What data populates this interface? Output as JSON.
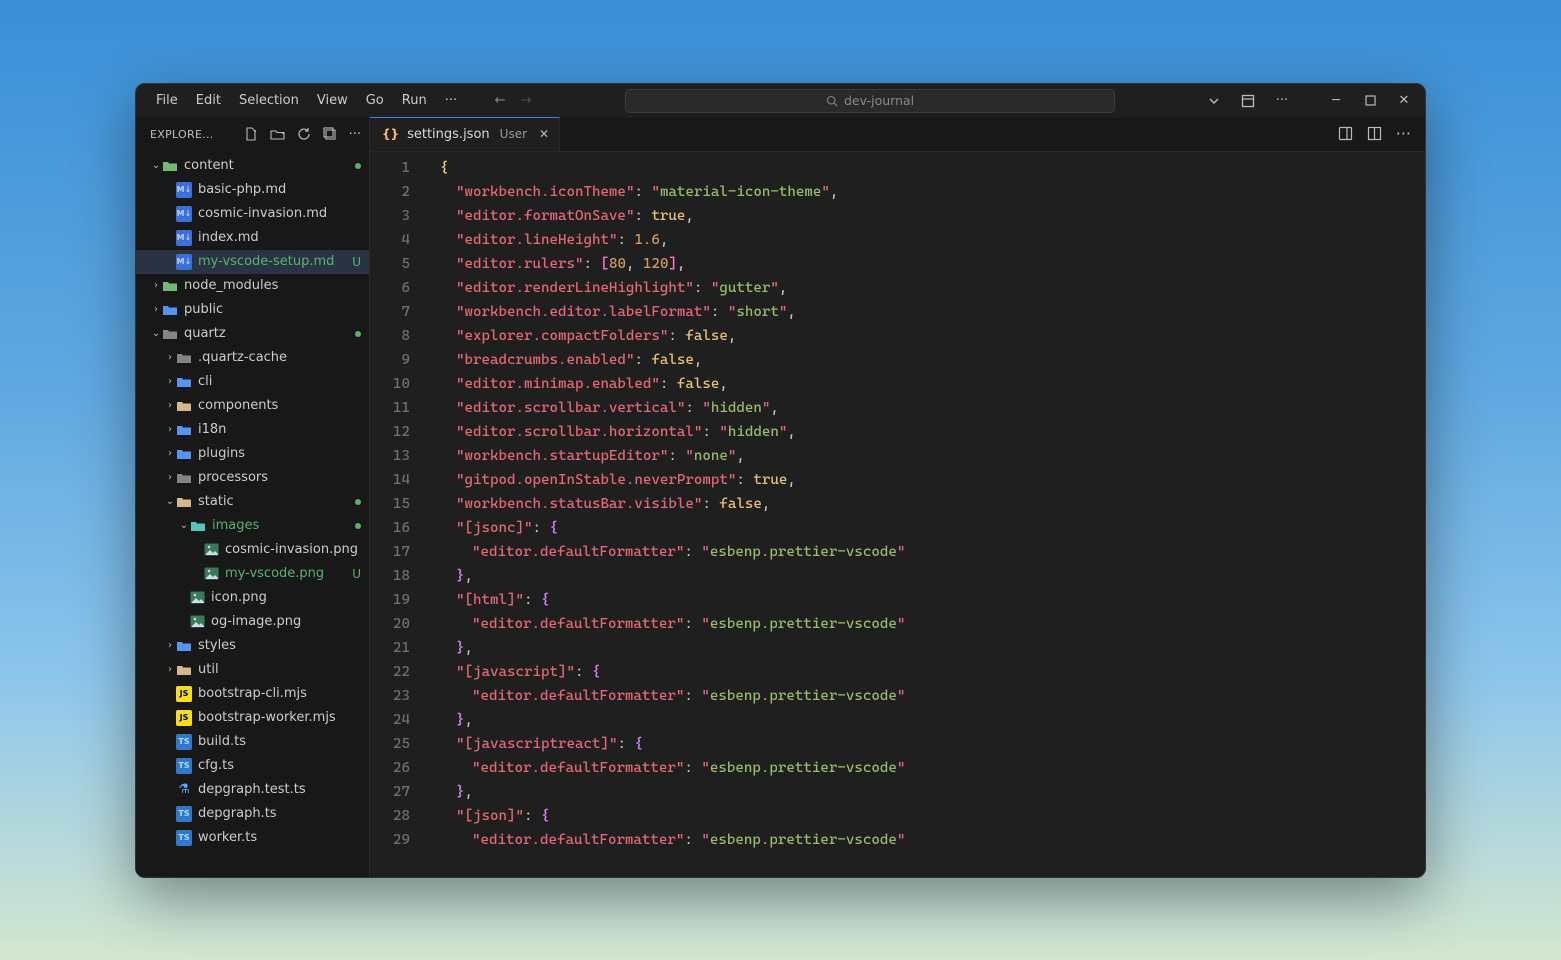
{
  "menu": {
    "file": "File",
    "edit": "Edit",
    "selection": "Selection",
    "view": "View",
    "go": "Go",
    "run": "Run"
  },
  "search_placeholder": "dev-journal",
  "sidebar": {
    "title": "EXPLORE...",
    "tree": [
      {
        "type": "folder",
        "label": "content",
        "indent": 0,
        "exp": true,
        "color": "green",
        "dot": true
      },
      {
        "type": "file",
        "label": "basic-php.md",
        "indent": 1,
        "badge": "M↓",
        "badgecls": "file-md"
      },
      {
        "type": "file",
        "label": "cosmic-invasion.md",
        "indent": 1,
        "badge": "M↓",
        "badgecls": "file-md"
      },
      {
        "type": "file",
        "label": "index.md",
        "indent": 1,
        "badge": "M↓",
        "badgecls": "file-md"
      },
      {
        "type": "file",
        "label": "my-vscode-setup.md",
        "indent": 1,
        "badge": "M↓",
        "badgecls": "file-md",
        "selected": true,
        "u": true,
        "labelcls": "green"
      },
      {
        "type": "folder",
        "label": "node_modules",
        "indent": 0,
        "exp": false,
        "color": "green"
      },
      {
        "type": "folder",
        "label": "public",
        "indent": 0,
        "exp": false,
        "color": "blue"
      },
      {
        "type": "folder",
        "label": "quartz",
        "indent": 0,
        "exp": true,
        "color": "grey",
        "dot": true
      },
      {
        "type": "folder",
        "label": ".quartz-cache",
        "indent": 1,
        "exp": false,
        "color": "grey"
      },
      {
        "type": "folder",
        "label": "cli",
        "indent": 1,
        "exp": false,
        "color": "blue"
      },
      {
        "type": "folder",
        "label": "components",
        "indent": 1,
        "exp": false,
        "color": "yellow"
      },
      {
        "type": "folder",
        "label": "i18n",
        "indent": 1,
        "exp": false,
        "color": "blue"
      },
      {
        "type": "folder",
        "label": "plugins",
        "indent": 1,
        "exp": false,
        "color": "blue"
      },
      {
        "type": "folder",
        "label": "processors",
        "indent": 1,
        "exp": false,
        "color": "grey"
      },
      {
        "type": "folder",
        "label": "static",
        "indent": 1,
        "exp": true,
        "color": "yellow",
        "dot": true
      },
      {
        "type": "folder",
        "label": "images",
        "indent": 2,
        "exp": true,
        "color": "teal",
        "labelcls": "green",
        "dot": true
      },
      {
        "type": "file",
        "label": "cosmic-invasion.png",
        "indent": 3,
        "badge": "",
        "badgecls": "png-badge"
      },
      {
        "type": "file",
        "label": "my-vscode.png",
        "indent": 3,
        "badge": "",
        "badgecls": "png-badge",
        "u": true,
        "labelcls": "green"
      },
      {
        "type": "file",
        "label": "icon.png",
        "indent": 2,
        "badge": "",
        "badgecls": "png-badge"
      },
      {
        "type": "file",
        "label": "og-image.png",
        "indent": 2,
        "badge": "",
        "badgecls": "png-badge"
      },
      {
        "type": "folder",
        "label": "styles",
        "indent": 1,
        "exp": false,
        "color": "blue"
      },
      {
        "type": "folder",
        "label": "util",
        "indent": 1,
        "exp": false,
        "color": "yellow"
      },
      {
        "type": "file",
        "label": "bootstrap-cli.mjs",
        "indent": 1,
        "badge": "JS",
        "badgecls": "js-badge"
      },
      {
        "type": "file",
        "label": "bootstrap-worker.mjs",
        "indent": 1,
        "badge": "JS",
        "badgecls": "js-badge"
      },
      {
        "type": "file",
        "label": "build.ts",
        "indent": 1,
        "badge": "TS",
        "badgecls": "ts-badge"
      },
      {
        "type": "file",
        "label": "cfg.ts",
        "indent": 1,
        "badge": "TS",
        "badgecls": "ts-badge"
      },
      {
        "type": "file",
        "label": "depgraph.test.ts",
        "indent": 1,
        "badge": "⚗",
        "badgecls": "test-badge"
      },
      {
        "type": "file",
        "label": "depgraph.ts",
        "indent": 1,
        "badge": "TS",
        "badgecls": "ts-badge"
      },
      {
        "type": "file",
        "label": "worker.ts",
        "indent": 1,
        "badge": "TS",
        "badgecls": "ts-badge"
      }
    ]
  },
  "tab": {
    "icon": "{}",
    "name": "settings.json",
    "scope": "User"
  },
  "code": {
    "lines": [
      [
        [
          "brace",
          "{"
        ]
      ],
      [
        [
          "ind",
          1
        ],
        [
          "q"
        ],
        [
          "key",
          "workbench.iconTheme"
        ],
        [
          "q"
        ],
        [
          "colon",
          ": "
        ],
        [
          "q"
        ],
        [
          "str",
          "material-icon-theme"
        ],
        [
          "q"
        ],
        [
          "punc",
          ","
        ]
      ],
      [
        [
          "ind",
          1
        ],
        [
          "q"
        ],
        [
          "key",
          "editor.formatOnSave"
        ],
        [
          "q"
        ],
        [
          "colon",
          ": "
        ],
        [
          "bool",
          "true"
        ],
        [
          "punc",
          ","
        ]
      ],
      [
        [
          "ind",
          1
        ],
        [
          "q"
        ],
        [
          "key",
          "editor.lineHeight"
        ],
        [
          "q"
        ],
        [
          "colon",
          ": "
        ],
        [
          "num",
          "1.6"
        ],
        [
          "punc",
          ","
        ]
      ],
      [
        [
          "ind",
          1
        ],
        [
          "q"
        ],
        [
          "key",
          "editor.rulers"
        ],
        [
          "q"
        ],
        [
          "colon",
          ": "
        ],
        [
          "bracket",
          "["
        ],
        [
          "num",
          "80"
        ],
        [
          "punc",
          ", "
        ],
        [
          "num",
          "120"
        ],
        [
          "bracket",
          "]"
        ],
        [
          "punc",
          ","
        ]
      ],
      [
        [
          "ind",
          1
        ],
        [
          "q"
        ],
        [
          "key",
          "editor.renderLineHighlight"
        ],
        [
          "q"
        ],
        [
          "colon",
          ": "
        ],
        [
          "q"
        ],
        [
          "str",
          "gutter"
        ],
        [
          "q"
        ],
        [
          "punc",
          ","
        ]
      ],
      [
        [
          "ind",
          1
        ],
        [
          "q"
        ],
        [
          "key",
          "workbench.editor.labelFormat"
        ],
        [
          "q"
        ],
        [
          "colon",
          ": "
        ],
        [
          "q"
        ],
        [
          "str",
          "short"
        ],
        [
          "q"
        ],
        [
          "punc",
          ","
        ]
      ],
      [
        [
          "ind",
          1
        ],
        [
          "q"
        ],
        [
          "key",
          "explorer.compactFolders"
        ],
        [
          "q"
        ],
        [
          "colon",
          ": "
        ],
        [
          "bool",
          "false"
        ],
        [
          "punc",
          ","
        ]
      ],
      [
        [
          "ind",
          1
        ],
        [
          "q"
        ],
        [
          "key",
          "breadcrumbs.enabled"
        ],
        [
          "q"
        ],
        [
          "colon",
          ": "
        ],
        [
          "bool",
          "false"
        ],
        [
          "punc",
          ","
        ]
      ],
      [
        [
          "ind",
          1
        ],
        [
          "q"
        ],
        [
          "key",
          "editor.minimap.enabled"
        ],
        [
          "q"
        ],
        [
          "colon",
          ": "
        ],
        [
          "bool",
          "false"
        ],
        [
          "punc",
          ","
        ]
      ],
      [
        [
          "ind",
          1
        ],
        [
          "q"
        ],
        [
          "key",
          "editor.scrollbar.vertical"
        ],
        [
          "q"
        ],
        [
          "colon",
          ": "
        ],
        [
          "q"
        ],
        [
          "str",
          "hidden"
        ],
        [
          "q"
        ],
        [
          "punc",
          ","
        ]
      ],
      [
        [
          "ind",
          1
        ],
        [
          "q"
        ],
        [
          "key",
          "editor.scrollbar.horizontal"
        ],
        [
          "q"
        ],
        [
          "colon",
          ": "
        ],
        [
          "q"
        ],
        [
          "str",
          "hidden"
        ],
        [
          "q"
        ],
        [
          "punc",
          ","
        ]
      ],
      [
        [
          "ind",
          1
        ],
        [
          "q"
        ],
        [
          "key",
          "workbench.startupEditor"
        ],
        [
          "q"
        ],
        [
          "colon",
          ": "
        ],
        [
          "q"
        ],
        [
          "str",
          "none"
        ],
        [
          "q"
        ],
        [
          "punc",
          ","
        ]
      ],
      [
        [
          "ind",
          1
        ],
        [
          "q"
        ],
        [
          "key",
          "gitpod.openInStable.neverPrompt"
        ],
        [
          "q"
        ],
        [
          "colon",
          ": "
        ],
        [
          "bool",
          "true"
        ],
        [
          "punc",
          ","
        ]
      ],
      [
        [
          "ind",
          1
        ],
        [
          "q"
        ],
        [
          "key",
          "workbench.statusBar.visible"
        ],
        [
          "q"
        ],
        [
          "colon",
          ": "
        ],
        [
          "bool",
          "false"
        ],
        [
          "punc",
          ","
        ]
      ],
      [
        [
          "ind",
          1
        ],
        [
          "q"
        ],
        [
          "key",
          "[jsonc]"
        ],
        [
          "q"
        ],
        [
          "colon",
          ": "
        ],
        [
          "brace2",
          "{"
        ]
      ],
      [
        [
          "ind",
          2
        ],
        [
          "q"
        ],
        [
          "key",
          "editor.defaultFormatter"
        ],
        [
          "q"
        ],
        [
          "colon",
          ": "
        ],
        [
          "q"
        ],
        [
          "str",
          "esbenp.prettier-vscode"
        ],
        [
          "q"
        ]
      ],
      [
        [
          "ind",
          1
        ],
        [
          "brace2",
          "}"
        ],
        [
          "punc",
          ","
        ]
      ],
      [
        [
          "ind",
          1
        ],
        [
          "q"
        ],
        [
          "key",
          "[html]"
        ],
        [
          "q"
        ],
        [
          "colon",
          ": "
        ],
        [
          "brace2",
          "{"
        ]
      ],
      [
        [
          "ind",
          2
        ],
        [
          "q"
        ],
        [
          "key",
          "editor.defaultFormatter"
        ],
        [
          "q"
        ],
        [
          "colon",
          ": "
        ],
        [
          "q"
        ],
        [
          "str",
          "esbenp.prettier-vscode"
        ],
        [
          "q"
        ]
      ],
      [
        [
          "ind",
          1
        ],
        [
          "brace2",
          "}"
        ],
        [
          "punc",
          ","
        ]
      ],
      [
        [
          "ind",
          1
        ],
        [
          "q"
        ],
        [
          "key",
          "[javascript]"
        ],
        [
          "q"
        ],
        [
          "colon",
          ": "
        ],
        [
          "brace2",
          "{"
        ]
      ],
      [
        [
          "ind",
          2
        ],
        [
          "q"
        ],
        [
          "key",
          "editor.defaultFormatter"
        ],
        [
          "q"
        ],
        [
          "colon",
          ": "
        ],
        [
          "q"
        ],
        [
          "str",
          "esbenp.prettier-vscode"
        ],
        [
          "q"
        ]
      ],
      [
        [
          "ind",
          1
        ],
        [
          "brace2",
          "}"
        ],
        [
          "punc",
          ","
        ]
      ],
      [
        [
          "ind",
          1
        ],
        [
          "q"
        ],
        [
          "key",
          "[javascriptreact]"
        ],
        [
          "q"
        ],
        [
          "colon",
          ": "
        ],
        [
          "brace2",
          "{"
        ]
      ],
      [
        [
          "ind",
          2
        ],
        [
          "q"
        ],
        [
          "key",
          "editor.defaultFormatter"
        ],
        [
          "q"
        ],
        [
          "colon",
          ": "
        ],
        [
          "q"
        ],
        [
          "str",
          "esbenp.prettier-vscode"
        ],
        [
          "q"
        ]
      ],
      [
        [
          "ind",
          1
        ],
        [
          "brace2",
          "}"
        ],
        [
          "punc",
          ","
        ]
      ],
      [
        [
          "ind",
          1
        ],
        [
          "q"
        ],
        [
          "key",
          "[json]"
        ],
        [
          "q"
        ],
        [
          "colon",
          ": "
        ],
        [
          "brace2",
          "{"
        ]
      ],
      [
        [
          "ind",
          2
        ],
        [
          "q"
        ],
        [
          "key",
          "editor.defaultFormatter"
        ],
        [
          "q"
        ],
        [
          "colon",
          ": "
        ],
        [
          "q"
        ],
        [
          "str",
          "esbenp.prettier-vscode"
        ],
        [
          "q"
        ]
      ]
    ]
  }
}
